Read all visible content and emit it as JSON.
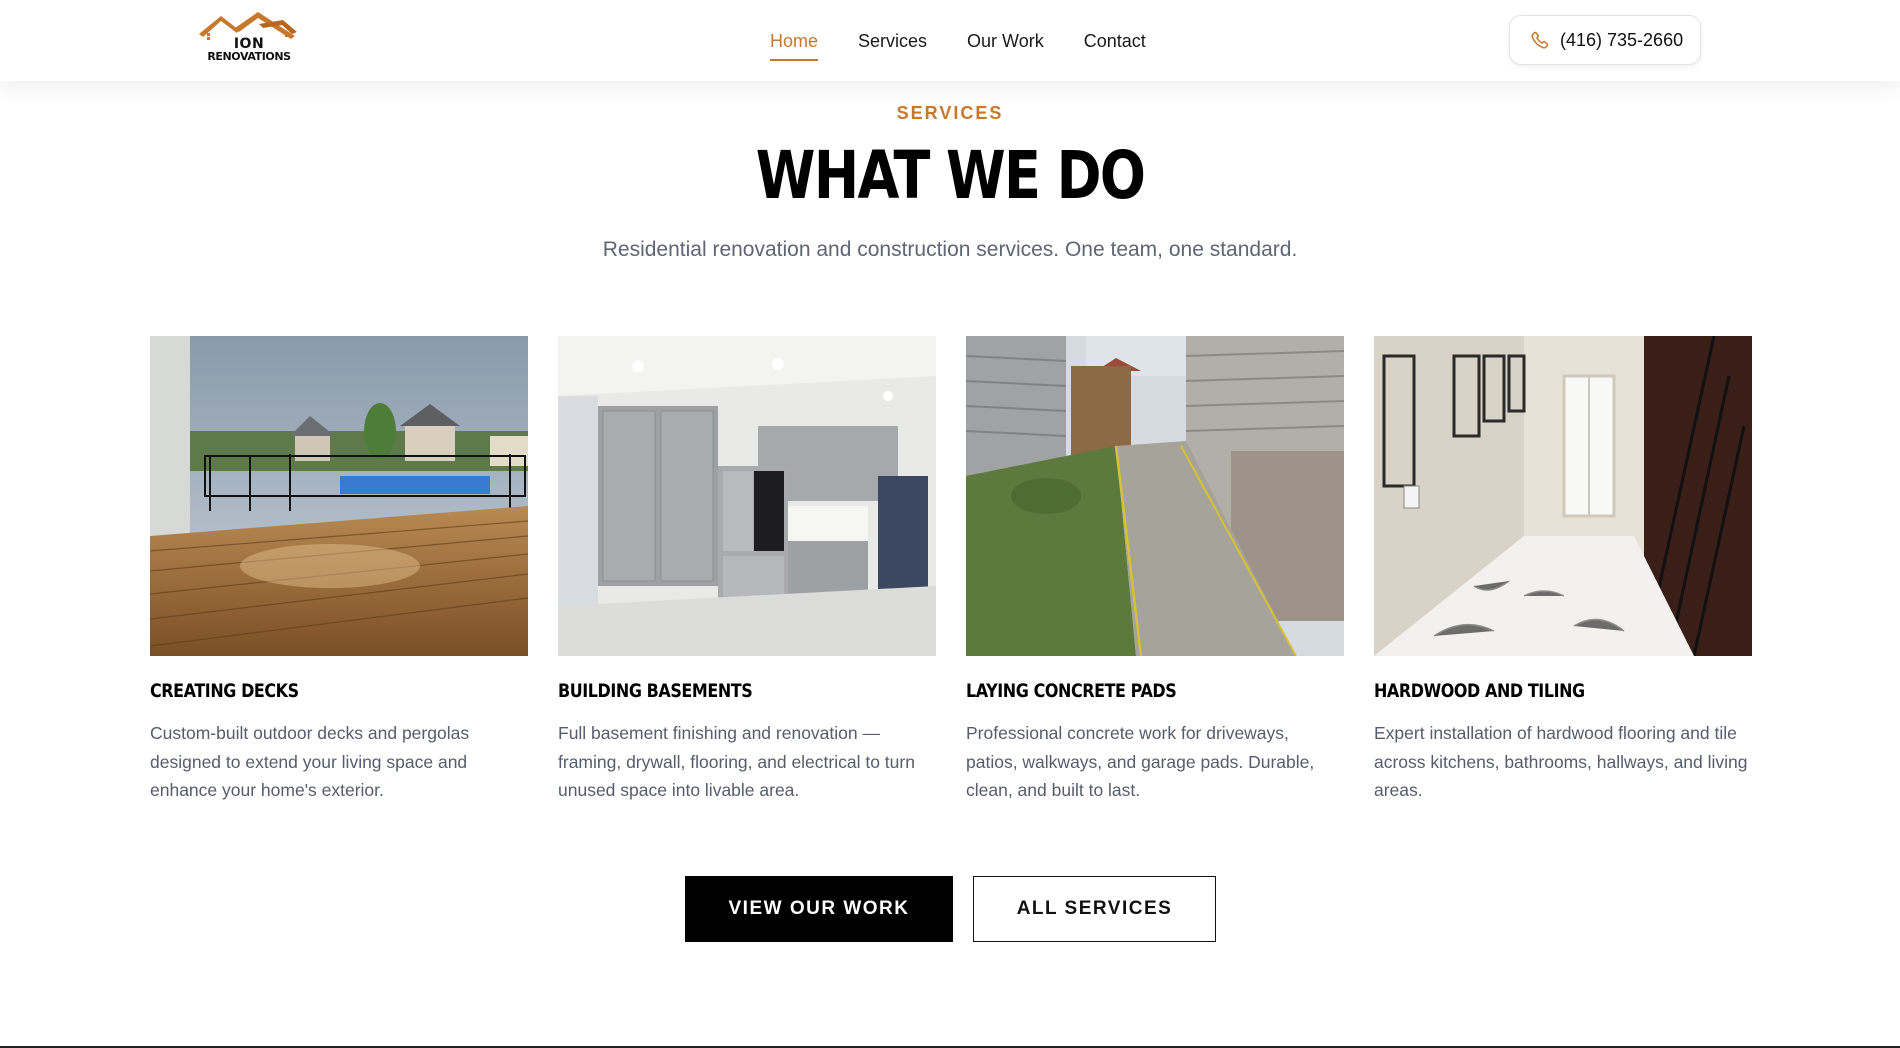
{
  "brand": {
    "logo_line1": "ION",
    "logo_line2": "RENOVATIONS",
    "accent": "#c7782b"
  },
  "nav": {
    "items": [
      {
        "label": "Home",
        "active": true
      },
      {
        "label": "Services",
        "active": false
      },
      {
        "label": "Our Work",
        "active": false
      },
      {
        "label": "Contact",
        "active": false
      }
    ]
  },
  "phone": {
    "icon": "phone-icon",
    "number": "(416) 735-2660"
  },
  "section": {
    "eyebrow": "SERVICES",
    "title": "WHAT WE DO",
    "subtitle": "Residential renovation and construction services. One team, one standard."
  },
  "cards": [
    {
      "title": "Creating Decks",
      "description": "Custom-built outdoor decks and pergolas designed to extend your living space and enhance your home's exterior.",
      "image": "deck-photo"
    },
    {
      "title": "Building Basements",
      "description": "Full basement finishing and renovation — framing, drywall, flooring, and electrical to turn unused space into livable area.",
      "image": "basement-kitchen-photo"
    },
    {
      "title": "Laying Concrete Pads",
      "description": "Professional concrete work for driveways, patios, walkways, and garage pads. Durable, clean, and built to last.",
      "image": "concrete-walkway-photo"
    },
    {
      "title": "Hardwood and Tiling",
      "description": "Expert installation of hardwood flooring and tile across kitchens, bathrooms, hallways, and living areas.",
      "image": "tiled-hallway-photo"
    }
  ],
  "buttons": {
    "primary": "VIEW OUR WORK",
    "secondary": "ALL SERVICES"
  }
}
